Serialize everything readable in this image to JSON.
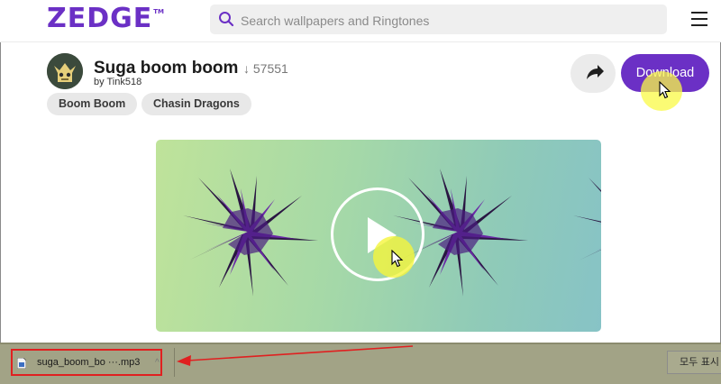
{
  "brand": {
    "name": "ZEDGE",
    "tm": "TM",
    "color": "#6b30c5"
  },
  "search": {
    "placeholder": "Search wallpapers and Ringtones"
  },
  "item": {
    "title": "Suga boom boom",
    "downloads": "↓ 57551",
    "author": "by Tink518",
    "tags": [
      "Boom Boom",
      "Chasin Dragons"
    ]
  },
  "actions": {
    "download_label": "Download"
  },
  "download_bar": {
    "file_name": "suga_boom_bo ···.mp3",
    "chevron": "^",
    "show_all_label": "모두 표시"
  },
  "colors": {
    "accent": "#6b30c5",
    "highlight": "#f5f53c",
    "annotation": "#e02020",
    "bar": "#a2a386"
  }
}
